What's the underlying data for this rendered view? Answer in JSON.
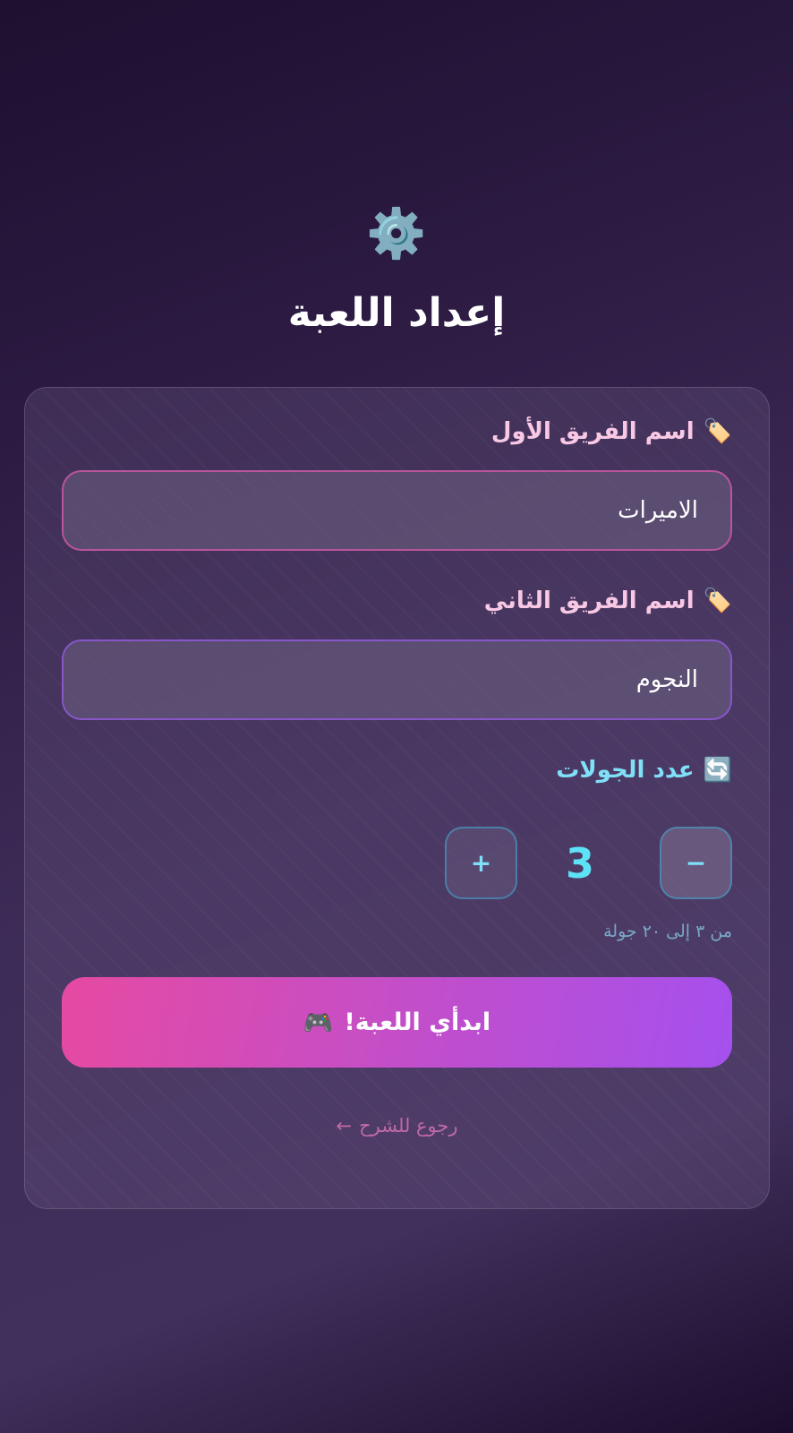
{
  "header": {
    "icon": "⚙️",
    "title": "إعداد اللعبة"
  },
  "form": {
    "team1": {
      "icon": "🏷️",
      "label": "اسم الفريق الأول",
      "value": "الاميرات"
    },
    "team2": {
      "icon": "🏷️",
      "label": "اسم الفريق الثاني",
      "value": "النجوم"
    },
    "rounds": {
      "icon": "🔄",
      "label": "عدد الجولات",
      "value": "3",
      "minus_label": "−",
      "plus_label": "+",
      "hint": "من ٣ إلى ٢٠ جولة"
    }
  },
  "start_button": {
    "label": "ابدأي اللعبة!",
    "icon": "🎮"
  },
  "back_link": {
    "label": "رجوع للشرح",
    "arrow": "←"
  },
  "colors": {
    "accent_pink": "#e64aa2",
    "accent_purple": "#a550ee",
    "accent_cyan": "#5ee2f6"
  }
}
